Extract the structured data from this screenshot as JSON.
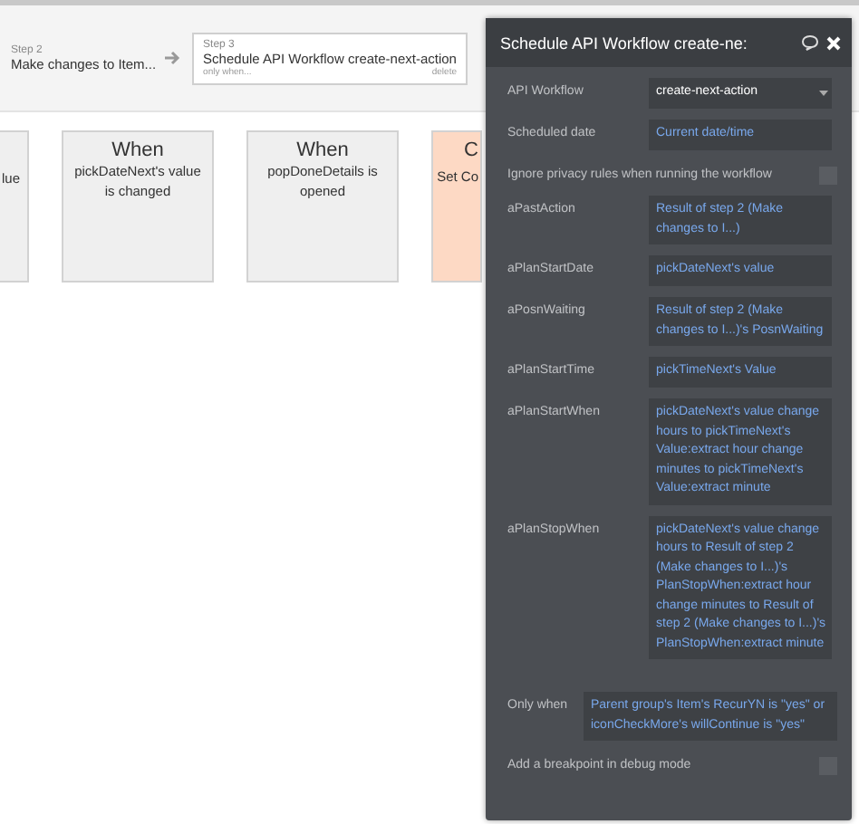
{
  "steps": [
    {
      "label": "Step 2",
      "title": "Make changes to Item...",
      "selected": false
    },
    {
      "label": "Step 3",
      "title": "Schedule API Workflow create-next-action",
      "condition": "only when...",
      "delete": "delete",
      "selected": true
    }
  ],
  "cards": [
    {
      "kind": "partial",
      "lines": [
        "lue"
      ]
    },
    {
      "kind": "event",
      "title": "When",
      "lines": [
        "pickDateNext's value",
        "is changed"
      ]
    },
    {
      "kind": "event",
      "title": "When",
      "lines": [
        "popDoneDetails is",
        "opened"
      ]
    },
    {
      "kind": "action",
      "title": "C",
      "lines": [
        "Set Co"
      ]
    }
  ],
  "panel": {
    "title": "Schedule API Workflow create-ne:",
    "fields": [
      {
        "kind": "dropdown",
        "label": "API Workflow",
        "value": "create-next-action"
      },
      {
        "kind": "expr",
        "label": "Scheduled date",
        "value": "Current date/time"
      },
      {
        "kind": "checkbox",
        "label": "Ignore privacy rules when running the workflow",
        "checked": false
      },
      {
        "kind": "expr",
        "label": "aPastAction",
        "value": "Result of step 2 (Make changes to I...)"
      },
      {
        "kind": "expr",
        "label": "aPlanStartDate",
        "value": "pickDateNext's value"
      },
      {
        "kind": "expr",
        "label": "aPosnWaiting",
        "value": "Result of step 2 (Make changes to I...)'s PosnWaiting"
      },
      {
        "kind": "expr",
        "label": "aPlanStartTime",
        "value": "pickTimeNext's Value"
      },
      {
        "kind": "expr",
        "label": "aPlanStartWhen",
        "value": "pickDateNext's value change hours to pickTimeNext's Value:extract hour change minutes to pickTimeNext's Value:extract minute"
      },
      {
        "kind": "expr",
        "label": "aPlanStopWhen",
        "value": "pickDateNext's value change hours to Result of step 2 (Make changes to I...)'s PlanStopWhen:extract hour change minutes to Result of step 2 (Make changes to I...)'s PlanStopWhen:extract minute"
      },
      {
        "kind": "condition",
        "label": "Only when",
        "value": "Parent group's Item's RecurYN is \"yes\" or iconCheckMore's willContinue is \"yes\""
      },
      {
        "kind": "checkbox",
        "label": "Add a breakpoint in debug mode",
        "checked": false
      }
    ]
  }
}
